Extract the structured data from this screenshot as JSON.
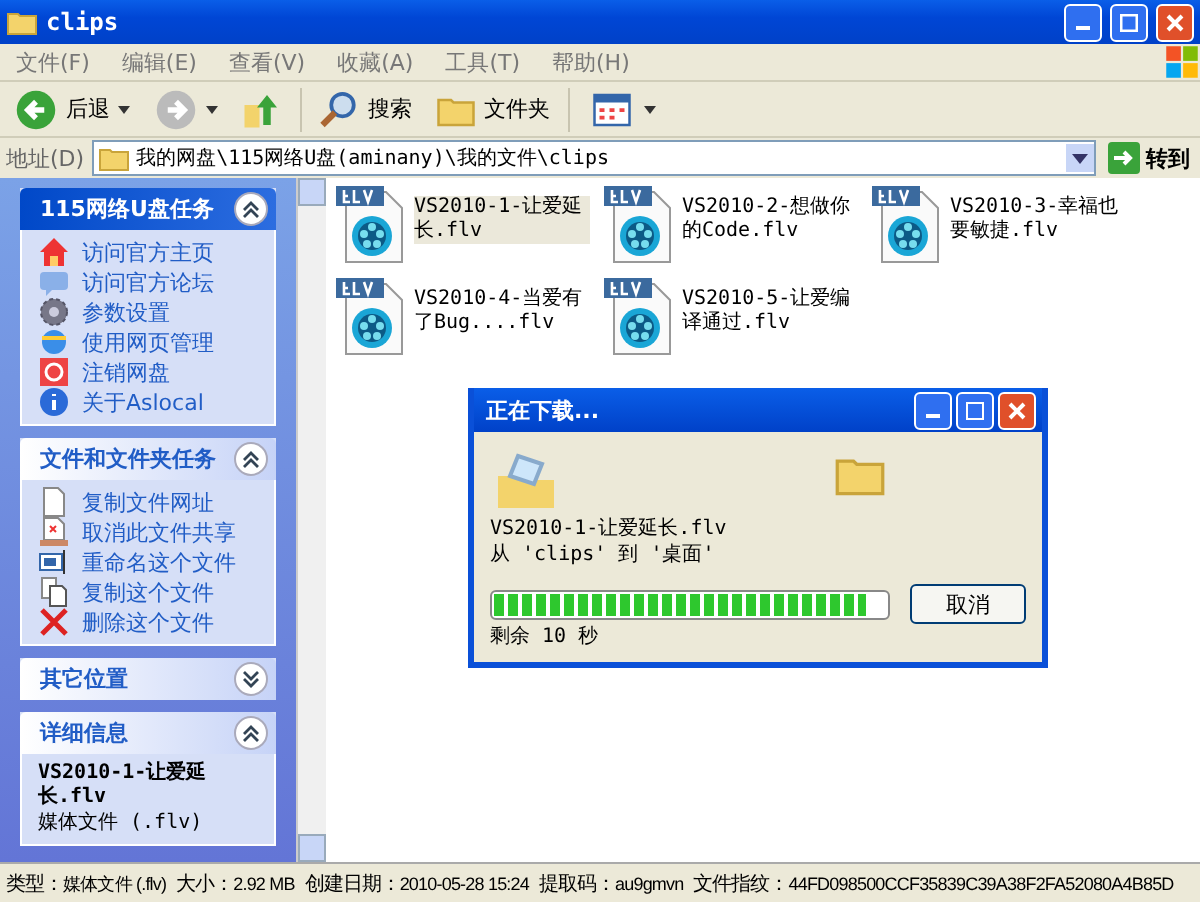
{
  "window": {
    "title": "clips"
  },
  "menu": [
    "文件(F)",
    "编辑(E)",
    "查看(V)",
    "收藏(A)",
    "工具(T)",
    "帮助(H)"
  ],
  "toolbar": [
    {
      "kind": "back",
      "label": "后退"
    },
    {
      "kind": "forward"
    },
    {
      "kind": "up"
    },
    {
      "kind": "search",
      "label": "搜索"
    },
    {
      "kind": "folders",
      "label": "文件夹"
    },
    {
      "kind": "views"
    }
  ],
  "address": {
    "label": "地址(D)",
    "value": "我的网盘\\115网络U盘(aminany)\\我的文件\\clips",
    "go": "转到"
  },
  "panels": [
    {
      "title": "115网络U盘任务",
      "expanded": true,
      "items": [
        {
          "kind": "home",
          "label": "访问官方主页"
        },
        {
          "kind": "forum",
          "label": "访问官方论坛"
        },
        {
          "kind": "gear",
          "label": "参数设置"
        },
        {
          "kind": "web",
          "label": "使用网页管理"
        },
        {
          "kind": "logout",
          "label": "注销网盘"
        },
        {
          "kind": "info",
          "label": "关于Aslocal"
        }
      ]
    },
    {
      "title": "文件和文件夹任务",
      "expanded": true,
      "items": [
        {
          "kind": "copyurl",
          "label": "复制文件网址"
        },
        {
          "kind": "unshare",
          "label": "取消此文件共享"
        },
        {
          "kind": "rename",
          "label": "重命名这个文件"
        },
        {
          "kind": "copy",
          "label": "复制这个文件"
        },
        {
          "kind": "delete",
          "label": "删除这个文件"
        }
      ]
    },
    {
      "title": "其它位置",
      "expanded": false
    },
    {
      "title": "详细信息",
      "expanded": true,
      "details": [
        "VS2010-1-让爱延长.flv",
        "媒体文件 (.flv)"
      ]
    }
  ],
  "files": [
    {
      "name": "VS2010-1-让爱延长.flv",
      "selected": true
    },
    {
      "name": "VS2010-2-想做你的Code.flv",
      "selected": false
    },
    {
      "name": "VS2010-3-幸福也要敏捷.flv",
      "selected": false
    },
    {
      "name": "VS2010-4-当爱有了Bug....flv",
      "selected": false
    },
    {
      "name": "VS2010-5-让爱编译通过.flv",
      "selected": false
    }
  ],
  "dialog": {
    "title": "正在下载...",
    "file": "VS2010-1-让爱延长.flv",
    "route": "从 'clips' 到 '桌面'",
    "level": 0.95,
    "remaining": "剩余 10 秒",
    "cancel": "取消"
  },
  "status": [
    {
      "label": "类型：",
      "value": "媒体文件 (.flv)"
    },
    {
      "label": "大小：",
      "value": "2.92 MB"
    },
    {
      "label": "创建日期：",
      "value": "2010-05-28 15:24"
    },
    {
      "label": "提取码：",
      "value": "au9gmvn"
    },
    {
      "label": "文件指纹：",
      "value": "44FD098500CCF35839C39A38F2FA52080A4B85D"
    }
  ]
}
